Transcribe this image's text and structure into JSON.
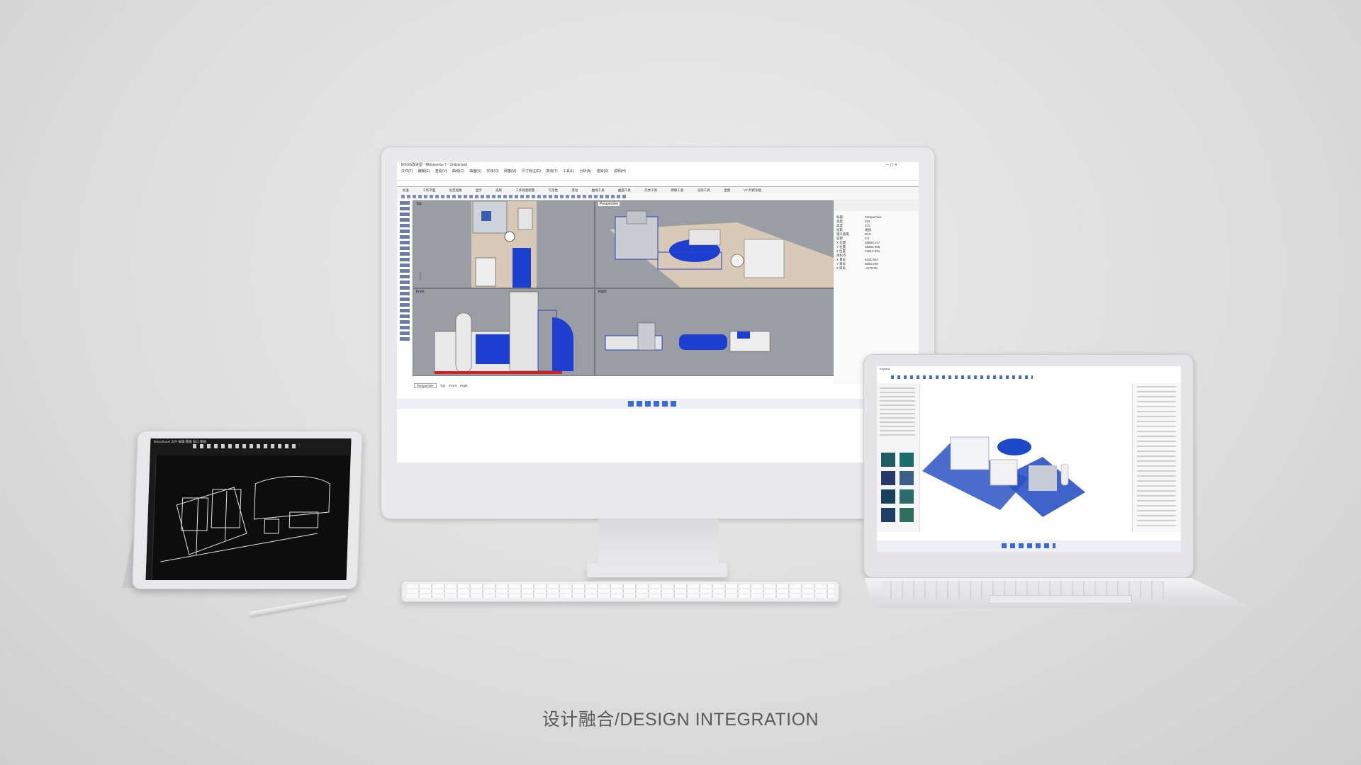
{
  "caption": "设计融合/DESIGN INTEGRATION",
  "monitor": {
    "app_title": "BOOG改进型 - Rhinoceros 7 - Unlicensed",
    "menu": [
      "文件(F)",
      "编辑(E)",
      "查看(V)",
      "曲线(C)",
      "曲面(S)",
      "实体(O)",
      "网格(M)",
      "尺寸标注(D)",
      "变动(T)",
      "工具(L)",
      "分析(A)",
      "渲染(R)",
      "说明(H)"
    ],
    "tabs": [
      "标准",
      "工作平面",
      "设定视图",
      "显示",
      "选取",
      "工作视窗配置",
      "可见性",
      "变动",
      "曲线工具",
      "曲面工具",
      "实体工具",
      "网格工具",
      "渲染工具",
      "出图",
      "V7 的新功能"
    ],
    "viewports": {
      "top": "Top",
      "perspective": "Perspective",
      "front": "Front",
      "right": "Right"
    },
    "viewport_tabs": [
      "Perspective",
      "Top",
      "Front",
      "Right"
    ],
    "props_rows": [
      "标题",
      "宽度",
      "高度",
      "投影",
      "镜头焦距",
      "旋转",
      "X 位置",
      "Y 位置",
      "Z 位置",
      "目标点",
      "X 目标",
      "Y 目标",
      "Z 目标"
    ],
    "props_vals": [
      "Perspective",
      "815",
      "372",
      "透视",
      "50.0",
      "0.0",
      "36583.417",
      "45204.905",
      "13614.231",
      "",
      "5421.904",
      "8665.939",
      "-4170.29"
    ]
  },
  "tablet": {
    "toolbar_text": "Sketchbook  文件  编辑  图像  窗口  帮助"
  },
  "laptop": {
    "app_title": "Keyshot"
  }
}
